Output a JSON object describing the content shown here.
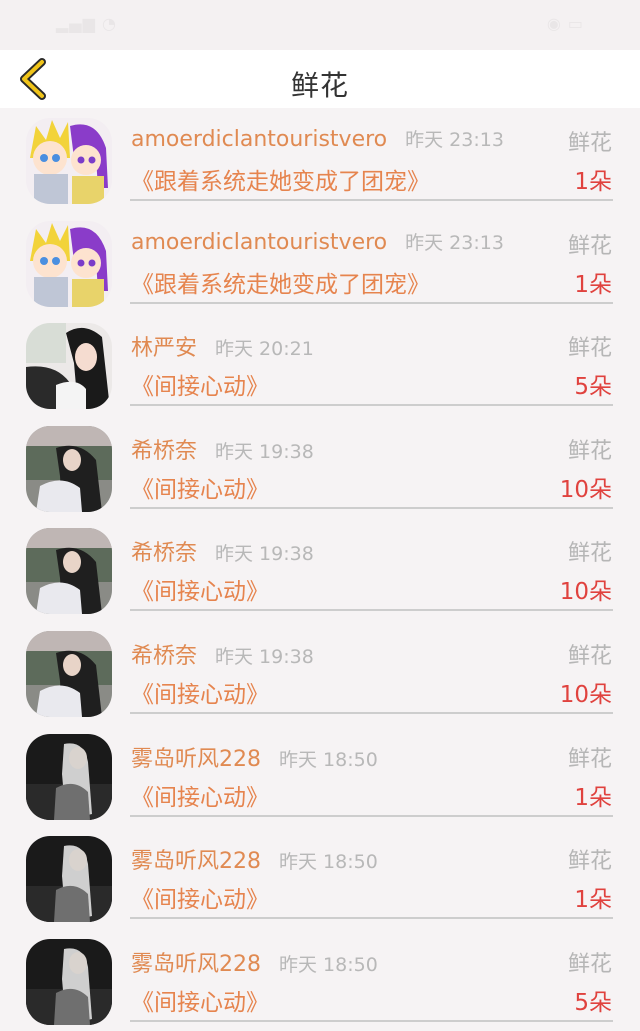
{
  "nav": {
    "title": "鲜花",
    "back_icon": "chevron-left-icon",
    "accent": "#f0c419"
  },
  "colors": {
    "name": "#e08a52",
    "book": "#e6844e",
    "count": "#e0423e",
    "time": "#b8b8b8"
  },
  "items": [
    {
      "name": "amoerdiclantouristvero",
      "time": "昨天 23:13",
      "gift": "鲜花",
      "book": "《跟着系统走她变成了团宠》",
      "count": "1朵",
      "avatar": "anime-couple"
    },
    {
      "name": "amoerdiclantouristvero",
      "time": "昨天 23:13",
      "gift": "鲜花",
      "book": "《跟着系统走她变成了团宠》",
      "count": "1朵",
      "avatar": "anime-couple"
    },
    {
      "name": "林严安",
      "time": "昨天 20:21",
      "gift": "鲜花",
      "book": "《间接心动》",
      "count": "5朵",
      "avatar": "girl-car"
    },
    {
      "name": "希桥奈",
      "time": "昨天 19:38",
      "gift": "鲜花",
      "book": "《间接心动》",
      "count": "10朵",
      "avatar": "girl-outdoor"
    },
    {
      "name": "希桥奈",
      "time": "昨天 19:38",
      "gift": "鲜花",
      "book": "《间接心动》",
      "count": "10朵",
      "avatar": "girl-outdoor"
    },
    {
      "name": "希桥奈",
      "time": "昨天 19:38",
      "gift": "鲜花",
      "book": "《间接心动》",
      "count": "10朵",
      "avatar": "girl-outdoor"
    },
    {
      "name": "雾岛听风228",
      "time": "昨天 18:50",
      "gift": "鲜花",
      "book": "《间接心动》",
      "count": "1朵",
      "avatar": "girl-dark"
    },
    {
      "name": "雾岛听风228",
      "time": "昨天 18:50",
      "gift": "鲜花",
      "book": "《间接心动》",
      "count": "1朵",
      "avatar": "girl-dark"
    },
    {
      "name": "雾岛听风228",
      "time": "昨天 18:50",
      "gift": "鲜花",
      "book": "《间接心动》",
      "count": "5朵",
      "avatar": "girl-dark"
    }
  ]
}
